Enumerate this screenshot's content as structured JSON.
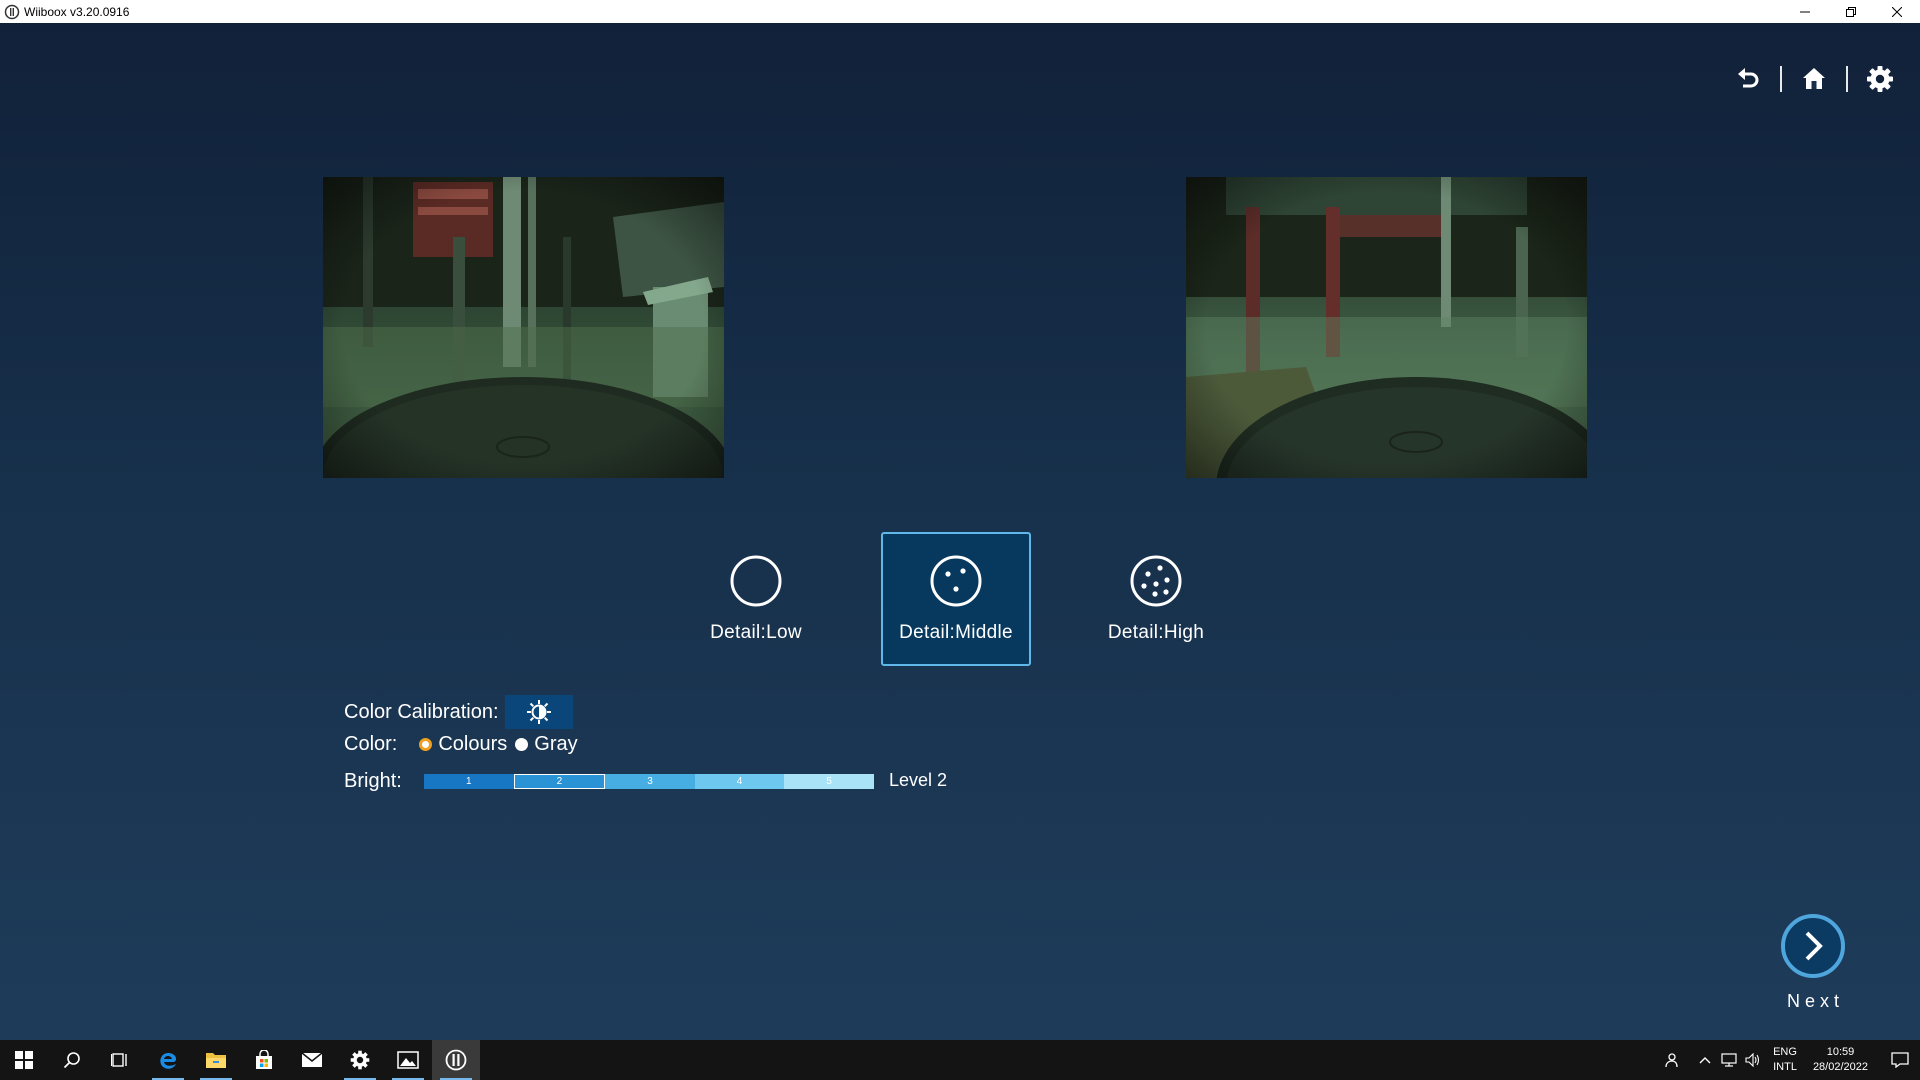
{
  "window": {
    "title": "Wiiboox v3.20.0916"
  },
  "top_icons": [
    "back-arrow-icon",
    "home-icon",
    "gear-icon"
  ],
  "detail_options": [
    {
      "label": "Detail:Low",
      "icon": "circle-empty-icon",
      "selected": false
    },
    {
      "label": "Detail:Middle",
      "icon": "circle-dots-few-icon",
      "selected": true
    },
    {
      "label": "Detail:High",
      "icon": "circle-dots-many-icon",
      "selected": false
    }
  ],
  "settings": {
    "calibration_label": "Color Calibration:",
    "color_label": "Color:",
    "color_options": [
      "Colours",
      "Gray"
    ],
    "color_selected": "Colours",
    "bright_label": "Bright:",
    "bright_segments": [
      "1",
      "2",
      "3",
      "4",
      "5"
    ],
    "bright_level": 2,
    "bright_level_text": "Level 2"
  },
  "next": {
    "label": "Next"
  },
  "taskbar": {
    "apps": [
      "windows-start-icon",
      "search-icon",
      "task-view-icon",
      "edge-icon",
      "file-explorer-icon",
      "store-icon",
      "mail-icon",
      "settings-icon",
      "photos-icon",
      "wiiboox-icon"
    ],
    "language_line1": "ENG",
    "language_line2": "INTL",
    "time": "10:59",
    "date": "28/02/2022"
  },
  "colors": {
    "accent": "#5fb7ea",
    "selected_bg": "#07385d",
    "radio_selected": "#f0a020",
    "bright_segments": [
      "#1777c4",
      "#2a93d6",
      "#46aee3",
      "#6dc7ee",
      "#a9e3f8"
    ]
  }
}
